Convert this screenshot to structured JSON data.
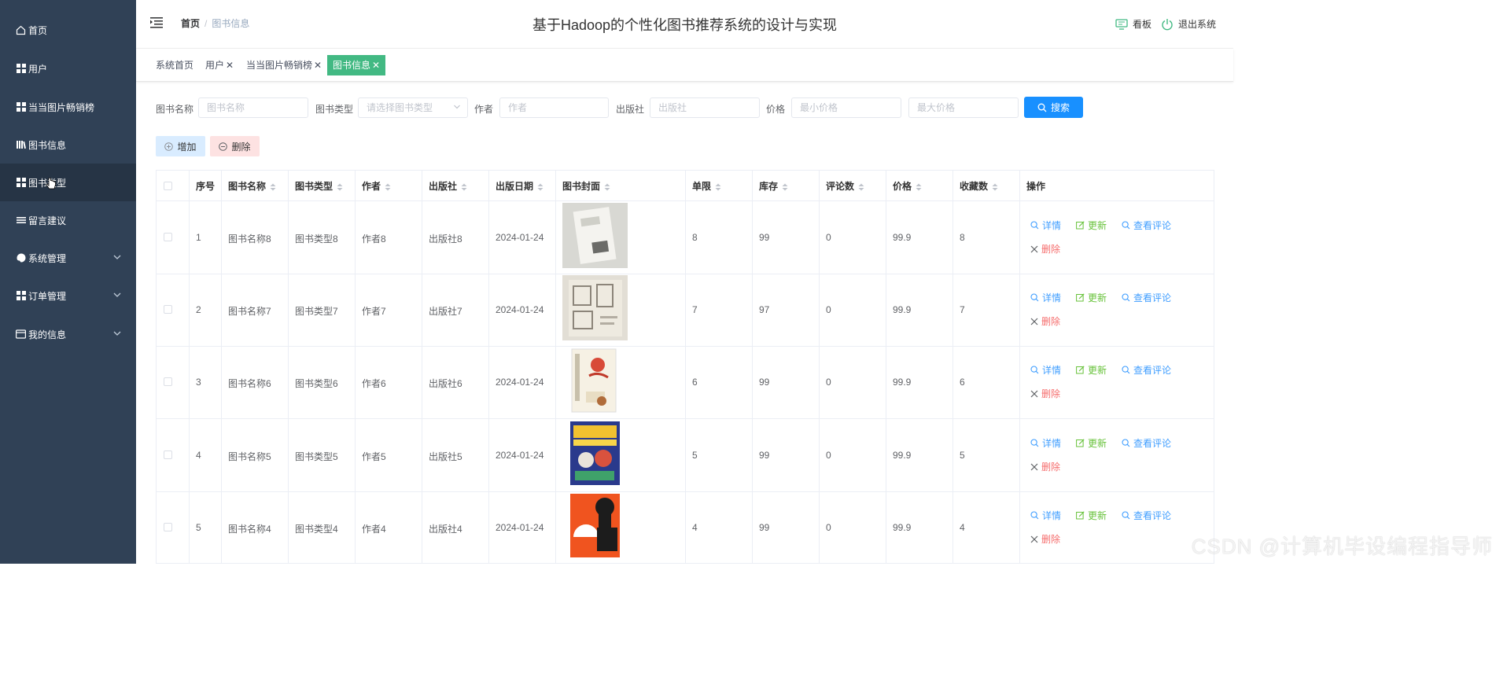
{
  "sidebar": {
    "items": [
      {
        "label": "首页"
      },
      {
        "label": "用户"
      },
      {
        "label": "当当图片畅销榜"
      },
      {
        "label": "图书信息"
      },
      {
        "label": "图书类型"
      },
      {
        "label": "留言建议"
      },
      {
        "label": "系统管理"
      },
      {
        "label": "订单管理"
      },
      {
        "label": "我的信息"
      }
    ]
  },
  "header": {
    "breadcrumb_home": "首页",
    "breadcrumb_sep": "/",
    "breadcrumb_current": "图书信息",
    "title": "基于Hadoop的个性化图书推荐系统的设计与实现",
    "board": "看板",
    "logout": "退出系统"
  },
  "tags": [
    {
      "label": "系统首页"
    },
    {
      "label": "用户"
    },
    {
      "label": "当当图片畅销榜"
    },
    {
      "label": "图书信息"
    }
  ],
  "filters": {
    "name_label": "图书名称",
    "name_placeholder": "图书名称",
    "type_label": "图书类型",
    "type_placeholder": "请选择图书类型",
    "author_label": "作者",
    "author_placeholder": "作者",
    "publisher_label": "出版社",
    "publisher_placeholder": "出版社",
    "price_label": "价格",
    "min_price_placeholder": "最小价格",
    "max_price_placeholder": "最大价格",
    "search_label": "搜索"
  },
  "toolbar": {
    "add_label": "增加",
    "delete_label": "删除"
  },
  "table": {
    "headers": [
      "序号",
      "图书名称",
      "图书类型",
      "作者",
      "出版社",
      "出版日期",
      "图书封面",
      "单限",
      "库存",
      "评论数",
      "价格",
      "收藏数",
      "操作"
    ],
    "actions": {
      "detail": "详情",
      "update": "更新",
      "comments": "查看评论",
      "delete": "删除"
    },
    "rows": [
      {
        "no": "1",
        "name": "图书名称8",
        "type": "图书类型8",
        "author": "作者8",
        "publisher": "出版社8",
        "date": "2024-01-24",
        "limit": "8",
        "stock": "99",
        "comments": "0",
        "price": "99.9",
        "favorites": "8",
        "cover": "book-cover-white"
      },
      {
        "no": "2",
        "name": "图书名称7",
        "type": "图书类型7",
        "author": "作者7",
        "publisher": "出版社7",
        "date": "2024-01-24",
        "limit": "7",
        "stock": "97",
        "comments": "0",
        "price": "99.9",
        "favorites": "7",
        "cover": "book-cover-beige"
      },
      {
        "no": "3",
        "name": "图书名称6",
        "type": "图书类型6",
        "author": "作者6",
        "publisher": "出版社6",
        "date": "2024-01-24",
        "limit": "6",
        "stock": "99",
        "comments": "0",
        "price": "99.9",
        "favorites": "6",
        "cover": "book-cover-cream"
      },
      {
        "no": "4",
        "name": "图书名称5",
        "type": "图书类型5",
        "author": "作者5",
        "publisher": "出版社5",
        "date": "2024-01-24",
        "limit": "5",
        "stock": "99",
        "comments": "0",
        "price": "99.9",
        "favorites": "5",
        "cover": "book-cover-blue"
      },
      {
        "no": "5",
        "name": "图书名称4",
        "type": "图书类型4",
        "author": "作者4",
        "publisher": "出版社4",
        "date": "2024-01-24",
        "limit": "4",
        "stock": "99",
        "comments": "0",
        "price": "99.9",
        "favorites": "4",
        "cover": "book-cover-orange"
      }
    ]
  },
  "watermark": "CSDN @计算机毕设编程指导师",
  "colors": {
    "sidebar_bg": "#304156",
    "active_tag": "#42b983",
    "primary": "#1890ff",
    "link": "#409eff"
  }
}
